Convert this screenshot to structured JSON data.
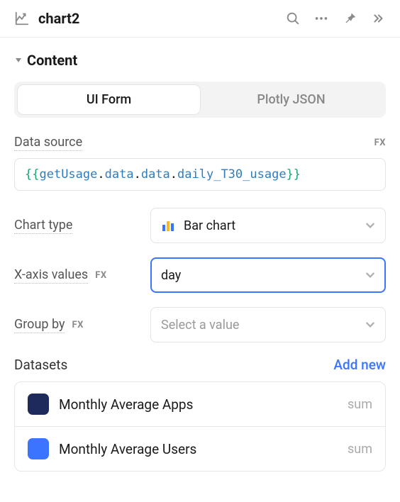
{
  "header": {
    "title": "chart2"
  },
  "section": {
    "title": "Content"
  },
  "tabs": {
    "ui_form": "UI Form",
    "plotly_json": "Plotly JSON"
  },
  "fields": {
    "data_source": {
      "label": "Data source",
      "fx": "FX",
      "expr": {
        "open": "{{",
        "close": "}}",
        "segments": [
          "getUsage",
          "data",
          "data",
          "daily_T30_usage"
        ]
      }
    },
    "chart_type": {
      "label": "Chart type",
      "value": "Bar chart"
    },
    "x_axis": {
      "label": "X-axis values",
      "fx": "FX",
      "value": "day"
    },
    "group_by": {
      "label": "Group by",
      "fx": "FX",
      "placeholder": "Select a value"
    }
  },
  "datasets": {
    "title": "Datasets",
    "add_label": "Add new",
    "items": [
      {
        "name": "Monthly Average Apps",
        "agg": "sum",
        "color": "#1f2a5c"
      },
      {
        "name": "Monthly Average Users",
        "agg": "sum",
        "color": "#3b74ff"
      }
    ]
  }
}
